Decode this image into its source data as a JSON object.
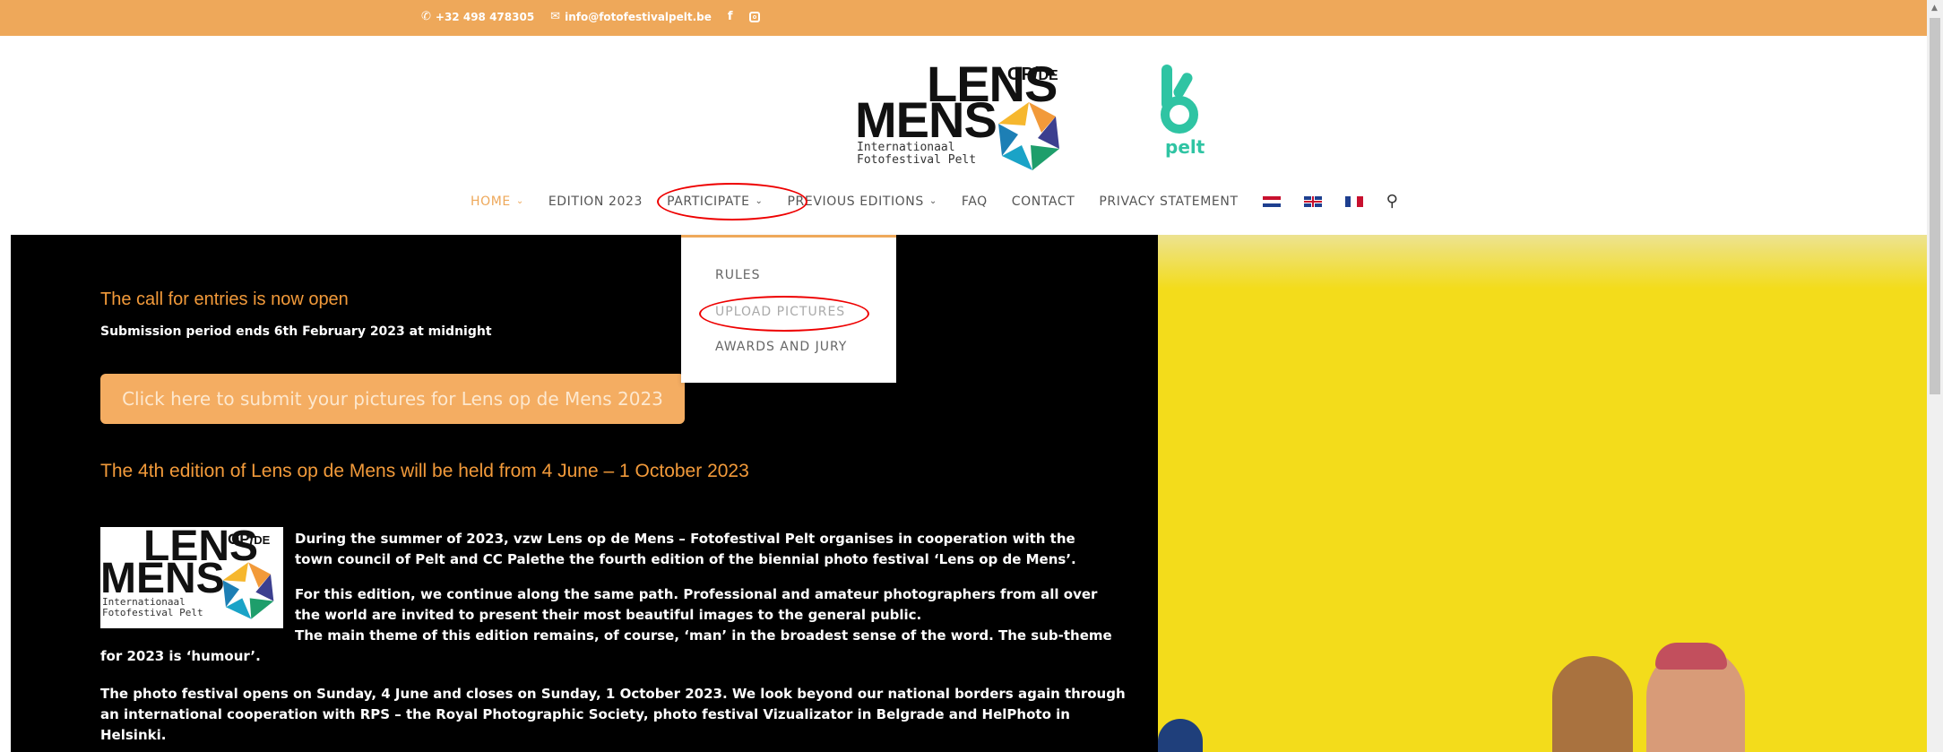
{
  "topbar": {
    "phone": "+32 498 478305",
    "email": "info@fotofestivalpelt.be",
    "social": [
      "facebook-icon",
      "instagram-icon"
    ]
  },
  "logo": {
    "lens": "LENS",
    "opde": "OP/DE",
    "mens": "MENS",
    "sub1": "Internationaal",
    "sub2": "Fotofestival Pelt"
  },
  "pelt_logo": {
    "text": "pelt",
    "color": "#2fc4a3"
  },
  "nav": {
    "items": [
      {
        "label": "HOME",
        "dropdown": true,
        "active": true
      },
      {
        "label": "EDITION 2023",
        "dropdown": false
      },
      {
        "label": "PARTICIPATE",
        "dropdown": true
      },
      {
        "label": "PREVIOUS EDITIONS",
        "dropdown": true
      },
      {
        "label": "FAQ",
        "dropdown": false
      },
      {
        "label": "CONTACT",
        "dropdown": false
      },
      {
        "label": "PRIVACY STATEMENT",
        "dropdown": false
      }
    ],
    "languages": [
      "nl-flag-icon",
      "en-flag-icon",
      "fr-flag-icon"
    ]
  },
  "submenu": {
    "items": [
      "RULES",
      "UPLOAD PICTURES",
      "AWARDS AND JURY"
    ]
  },
  "content": {
    "call_title": "The call for entries is now open",
    "call_sub": "Submission period ends 6th February 2023 at midnight",
    "cta": "Click here to submit your pictures for Lens op de Mens 2023",
    "edition_title": "The 4th edition of Lens op de Mens will be held from 4 June – 1 October 2023",
    "para1_line1": "During the summer of 2023, vzw Lens op de Mens – Fotofestival Pelt organises in cooperation with the",
    "para1_line2": "town council of Pelt and CC Palethe the fourth edition of the biennial photo festival ‘Lens op de Mens’.",
    "para2_line1": "For this edition, we continue along the same path. Professional and amateur photographers from all over",
    "para2_line2": "the world are invited to present their most beautiful images to the general public.",
    "para2_line3": "The main theme of this edition remains, of course, ‘man’ in the broadest sense of the word. The sub-theme",
    "para2_line4": "for 2023 is ‘humour’.",
    "para3_line1": "The photo festival opens on Sunday, 4 June and closes on Sunday, 1 October 2023. We look beyond our national borders again through",
    "para3_line2": "an international cooperation with RPS – the Royal Photographic Society, photo festival Vizualizator in Belgrade and HelPhoto in",
    "para3_line3": "Helsinki."
  },
  "colors": {
    "accent": "#eea85a",
    "heading": "#f29a3a",
    "main_bg": "#000000",
    "photo_bg": "#f3dc1b"
  }
}
